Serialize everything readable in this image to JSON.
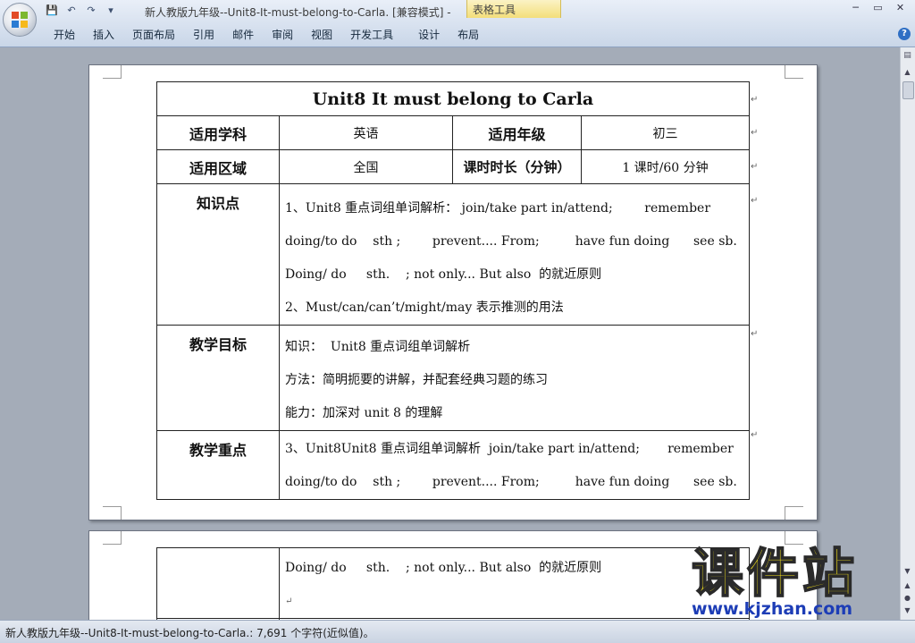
{
  "window": {
    "title": "新人教版九年级--Unit8-It-must-belong-to-Carla. [兼容模式] -",
    "context_tab_label": "表格工具",
    "minimize": "─",
    "restore": "▭",
    "close": "✕"
  },
  "quick_access": {
    "save": "💾",
    "undo": "↶",
    "redo": "↷",
    "customize": "▾"
  },
  "ribbon": {
    "tabs": [
      "开始",
      "插入",
      "页面布局",
      "引用",
      "邮件",
      "审阅",
      "视图",
      "开发工具",
      "设计",
      "布局"
    ],
    "help": "?"
  },
  "document": {
    "title": "Unit8 It must belong to Carla",
    "row1": {
      "label_subject": "适用学科",
      "subject": "英语",
      "label_grade": "适用年级",
      "grade": "初三"
    },
    "row2": {
      "label_region": "适用区域",
      "region": "全国",
      "label_duration": "课时时长（分钟）",
      "duration": "1 课时/60 分钟"
    },
    "knowledge": {
      "label": "知识点",
      "lines": [
        "1、Unit8 重点词组单词解析： join/take part in/attend;        remember",
        "doing/to do    sth ;        prevent.... From;         have fun doing      see sb.",
        "Doing/ do     sth.    ; not only... But also  的就近原则",
        "2、Must/can/can’t/might/may 表示推测的用法"
      ]
    },
    "goals": {
      "label": "教学目标",
      "lines": [
        "知识：  Unit8 重点词组单词解析",
        "方法：简明扼要的讲解，并配套经典习题的练习",
        "能力：加深对 unit 8 的理解"
      ]
    },
    "focus": {
      "label": "教学重点",
      "lines": [
        "3、Unit8Unit8 重点词组单词解析  join/take part in/attend;       remember",
        "doing/to do    sth ;        prevent.... From;         have fun doing      see sb."
      ]
    },
    "page2": {
      "lines": [
        "Doing/ do     sth.    ; not only... But also  的就近原则",
        ""
      ]
    },
    "para_mark": "↵"
  },
  "status": {
    "text": "新人教版九年级--Unit8-It-must-belong-to-Carla.: 7,691 个字符(近似值)。"
  },
  "watermark": {
    "title": "课件站",
    "url": "www.kjzhan.com"
  },
  "colors": {
    "ribbon_bg": "#dbe5f1",
    "workspace": "#a4acb8",
    "watermark_yellow": "#f3e11b",
    "watermark_blue": "#1d3db6"
  }
}
